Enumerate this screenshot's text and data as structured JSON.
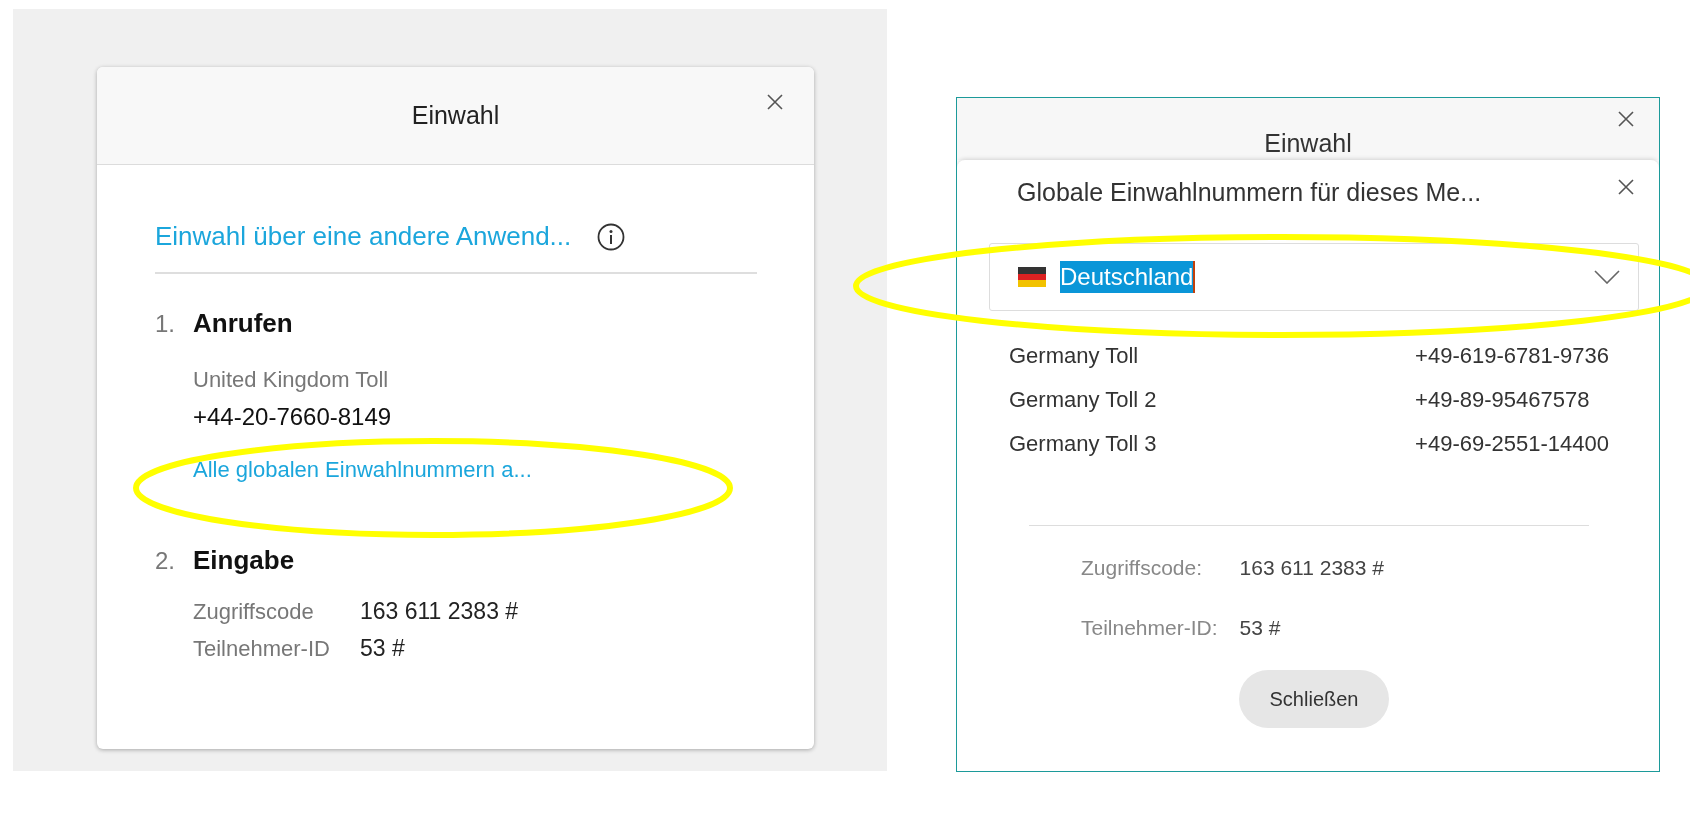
{
  "left_dialog": {
    "title": "Einwahl",
    "alt_dial_link": "Einwahl über eine andere Anwend...",
    "call_step": {
      "number": "1.",
      "title": "Anrufen",
      "country": "United Kingdom Toll",
      "phone": "+44-20-7660-8149",
      "link": "Alle globalen Einwahlnummern a..."
    },
    "enter_step": {
      "number": "2.",
      "title": "Eingabe",
      "fields": [
        {
          "label": "Zugriffscode",
          "value": "163 611 2383 #"
        },
        {
          "label": "Teilnehmer-ID",
          "value": "53 #"
        }
      ]
    }
  },
  "right_panel": {
    "background_title": "Einwahl",
    "dialog": {
      "title": "Globale Einwahlnummern für dieses Me...",
      "country_select": {
        "value": "Deutschland"
      },
      "numbers": [
        {
          "name": "Germany Toll",
          "number": "+49-619-6781-9736"
        },
        {
          "name": "Germany Toll 2",
          "number": "+49-89-95467578"
        },
        {
          "name": "Germany Toll 3",
          "number": "+49-69-2551-14400"
        }
      ],
      "fields": [
        {
          "label": "Zugriffscode:",
          "value": "163 611 2383 #"
        },
        {
          "label": "Teilnehmer-ID:",
          "value": "53 #"
        }
      ],
      "button": "Schließen"
    }
  }
}
